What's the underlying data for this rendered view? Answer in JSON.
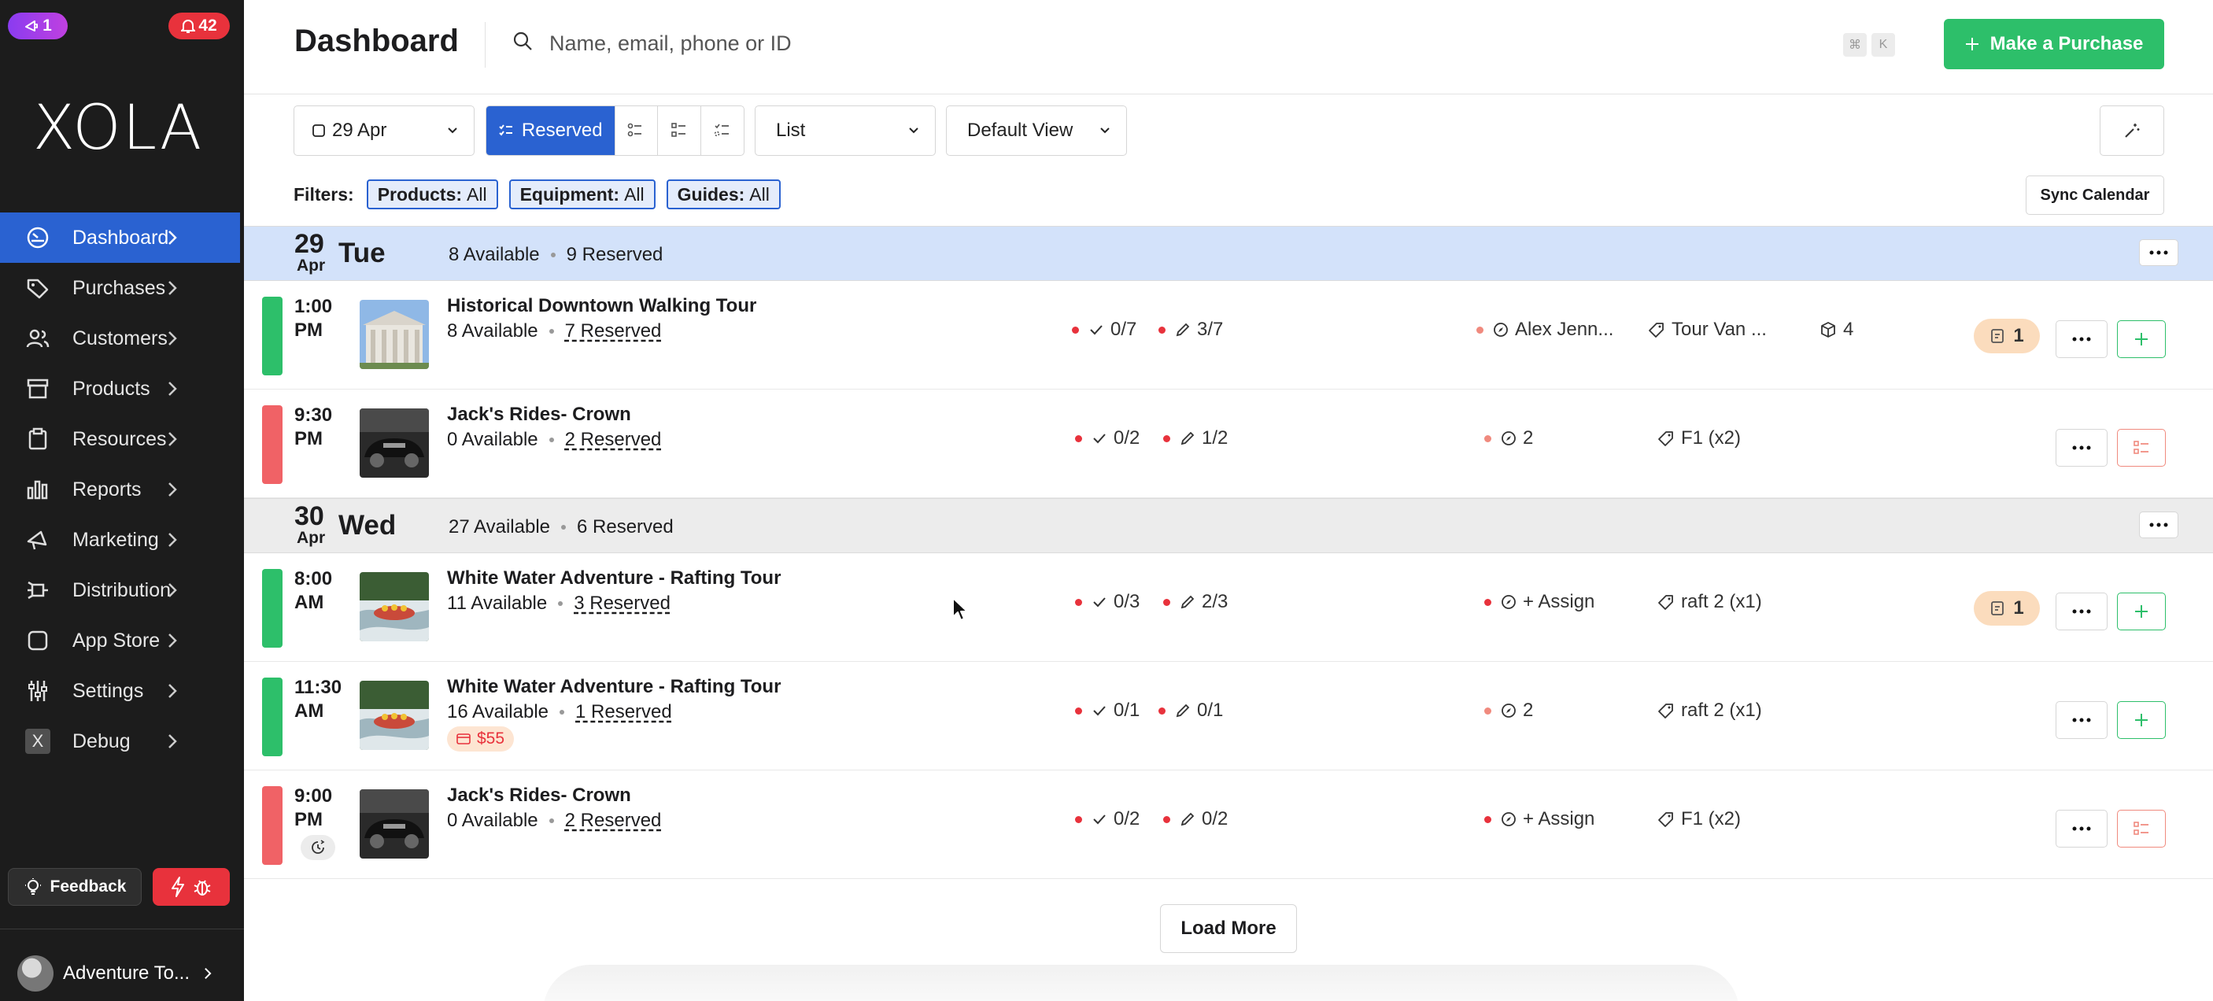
{
  "sidebar": {
    "promo_badge": "1",
    "notification_count": "42",
    "logo": "XOLA",
    "items": [
      {
        "label": "Dashboard"
      },
      {
        "label": "Purchases"
      },
      {
        "label": "Customers"
      },
      {
        "label": "Products"
      },
      {
        "label": "Resources"
      },
      {
        "label": "Reports"
      },
      {
        "label": "Marketing"
      },
      {
        "label": "Distribution"
      },
      {
        "label": "App Store"
      },
      {
        "label": "Settings"
      },
      {
        "label": "Debug",
        "icon_text": "X"
      }
    ],
    "feedback_label": "Feedback",
    "account_name": "Adventure To..."
  },
  "header": {
    "title": "Dashboard",
    "search_placeholder": "Name, email, phone or ID",
    "shortcut_keys": [
      "⌘",
      "K"
    ],
    "purchase_button": "Make a Purchase"
  },
  "toolbar": {
    "date": "29 Apr",
    "reserved_label": "Reserved",
    "list_label": "List",
    "view_label": "Default View"
  },
  "filters": {
    "label": "Filters:",
    "chips": [
      {
        "name": "Products:",
        "value": "All"
      },
      {
        "name": "Equipment:",
        "value": "All"
      },
      {
        "name": "Guides:",
        "value": "All"
      }
    ],
    "sync_label": "Sync Calendar"
  },
  "days": [
    {
      "num": "29",
      "month": "Apr",
      "weekday": "Tue",
      "available": "8 Available",
      "reserved": "9 Reserved",
      "events": [
        {
          "time1": "1:00",
          "time2": "PM",
          "status_color": "#2dbf6a",
          "thumb": "building",
          "name": "Historical Downtown Walking Tour",
          "available": "8 Available",
          "reserved": "7 Reserved",
          "checkin": "0/7",
          "waiver": "3/7",
          "guide": "Alex Jenn...",
          "equipment": "Tour Van ...",
          "boxes": "4",
          "notes": "1",
          "action": "add"
        },
        {
          "time1": "9:30",
          "time2": "PM",
          "status_color": "#f06266",
          "thumb": "car",
          "name": "Jack's Rides- Crown",
          "available": "0 Available",
          "reserved": "2 Reserved",
          "checkin": "0/2",
          "waiver": "1/2",
          "guide": "2",
          "equipment": "F1 (x2)",
          "action": "full"
        }
      ]
    },
    {
      "num": "30",
      "month": "Apr",
      "weekday": "Wed",
      "available": "27 Available",
      "reserved": "6 Reserved",
      "events": [
        {
          "time1": "8:00",
          "time2": "AM",
          "status_color": "#2dbf6a",
          "thumb": "raft",
          "name": "White Water Adventure - Rafting Tour",
          "available": "11 Available",
          "reserved": "3 Reserved",
          "checkin": "0/3",
          "waiver": "2/3",
          "guide": "+ Assign",
          "equipment": "raft 2 (x1)",
          "notes": "1",
          "action": "add"
        },
        {
          "time1": "11:30",
          "time2": "AM",
          "status_color": "#2dbf6a",
          "thumb": "raft",
          "name": "White Water Adventure - Rafting Tour",
          "available": "16 Available",
          "reserved": "1 Reserved",
          "price": "$55",
          "checkin": "0/1",
          "waiver": "0/1",
          "guide": "2",
          "equipment": "raft 2 (x1)",
          "action": "add"
        },
        {
          "time1": "9:00",
          "time2": "PM",
          "status_color": "#f06266",
          "thumb": "car",
          "name": "Jack's Rides- Crown",
          "available": "0 Available",
          "reserved": "2 Reserved",
          "checkin": "0/2",
          "waiver": "0/2",
          "guide": "+ Assign",
          "equipment": "F1 (x2)",
          "action": "full"
        }
      ]
    }
  ],
  "load_more": "Load More",
  "colors": {
    "accent": "#2a62d1",
    "success": "#2dbf6a",
    "danger": "#e8323c",
    "sidebar": "#1c1c1c"
  }
}
